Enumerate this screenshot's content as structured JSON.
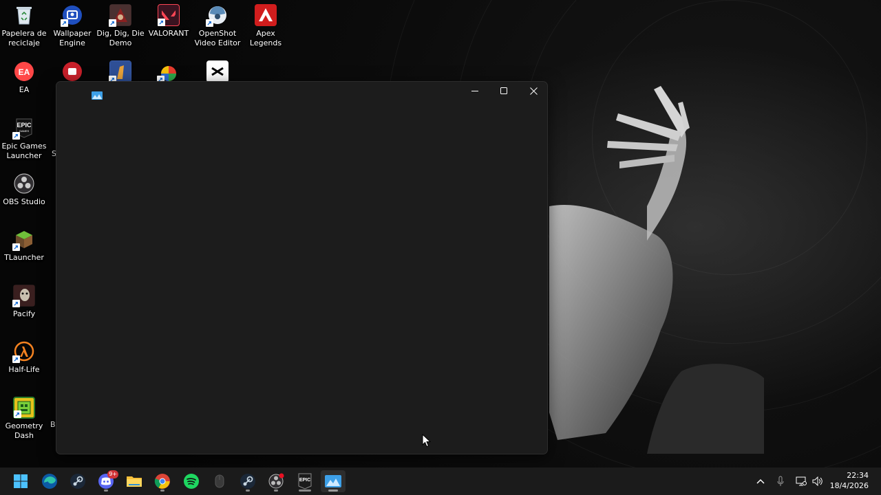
{
  "desktop": {
    "icons": [
      {
        "id": "recycle-bin",
        "label": "Papelera de reciclaje"
      },
      {
        "id": "wallpaper-engine",
        "label": "Wallpaper Engine"
      },
      {
        "id": "dig-dig-die",
        "label": "Dig, Dig, Die Demo"
      },
      {
        "id": "valorant",
        "label": "VALORANT"
      },
      {
        "id": "openshot",
        "label": "OpenShot Video Editor"
      },
      {
        "id": "apex",
        "label": "Apex Legends"
      },
      {
        "id": "ea",
        "label": "EA"
      },
      {
        "id": "epic",
        "label": "Epic Games Launcher"
      },
      {
        "id": "obs",
        "label": "OBS Studio"
      },
      {
        "id": "tlauncher",
        "label": "TLauncher"
      },
      {
        "id": "pacify",
        "label": "Pacify"
      },
      {
        "id": "half-life",
        "label": "Half-Life"
      },
      {
        "id": "geometry-dash",
        "label": "Geometry Dash"
      }
    ],
    "clipped_labels": [
      "S",
      "B"
    ]
  },
  "window": {
    "app_icon": "wallpaper-engine-picture-icon",
    "controls": {
      "minimize": "minimize-icon",
      "maximize": "maximize-icon",
      "close": "close-icon"
    }
  },
  "taskbar": {
    "apps": [
      "start",
      "edge",
      "steam",
      "discord",
      "file-explorer",
      "chrome",
      "spotify",
      "mouse-app",
      "steam-2",
      "obs",
      "epic-games",
      "wallpaper-engine"
    ],
    "discord_badge": "9+",
    "tray": [
      "chevron-up-icon",
      "microphone-icon",
      "network-icon",
      "speaker-icon"
    ],
    "time": "22:34",
    "date": "18/4/2026"
  },
  "colors": {
    "window_bg": "#1c1c1c",
    "taskbar_bg": "#1b1b1b",
    "accent": "#0078d4"
  }
}
